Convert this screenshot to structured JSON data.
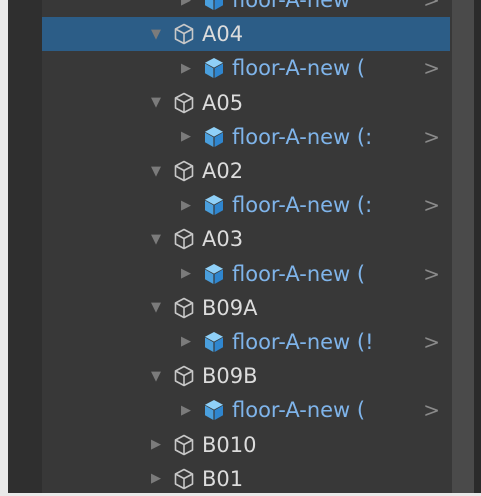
{
  "hierarchy": {
    "rows": [
      {
        "label": "floor-A-new",
        "kind": "prefab",
        "expanded": false,
        "selected": false
      },
      {
        "label": "A04",
        "kind": "object",
        "expanded": true,
        "selected": true
      },
      {
        "label": "floor-A-new (",
        "kind": "prefab",
        "expanded": false,
        "selected": false
      },
      {
        "label": "A05",
        "kind": "object",
        "expanded": true,
        "selected": false
      },
      {
        "label": "floor-A-new (:",
        "kind": "prefab",
        "expanded": false,
        "selected": false
      },
      {
        "label": "A02",
        "kind": "object",
        "expanded": true,
        "selected": false
      },
      {
        "label": "floor-A-new (:",
        "kind": "prefab",
        "expanded": false,
        "selected": false
      },
      {
        "label": "A03",
        "kind": "object",
        "expanded": true,
        "selected": false
      },
      {
        "label": "floor-A-new (",
        "kind": "prefab",
        "expanded": false,
        "selected": false
      },
      {
        "label": "B09A",
        "kind": "object",
        "expanded": true,
        "selected": false
      },
      {
        "label": "floor-A-new (!",
        "kind": "prefab",
        "expanded": false,
        "selected": false
      },
      {
        "label": "B09B",
        "kind": "object",
        "expanded": true,
        "selected": false
      },
      {
        "label": "floor-A-new (",
        "kind": "prefab",
        "expanded": false,
        "selected": false
      },
      {
        "label": "B010",
        "kind": "object",
        "expanded": false,
        "selected": false
      },
      {
        "label": "B01",
        "kind": "object",
        "expanded": false,
        "selected": false
      }
    ],
    "open_prefab_glyph": ">"
  },
  "colors": {
    "selection": "#2c5d87",
    "prefab_text": "#7fb4ea",
    "prefab_icon": "#5fb2ea",
    "panel_bg": "#383838"
  },
  "icons": {
    "expanded": "triangle-down-icon",
    "collapsed": "triangle-right-icon",
    "gameobject": "cube-outline-icon",
    "prefab": "prefab-cube-icon"
  }
}
